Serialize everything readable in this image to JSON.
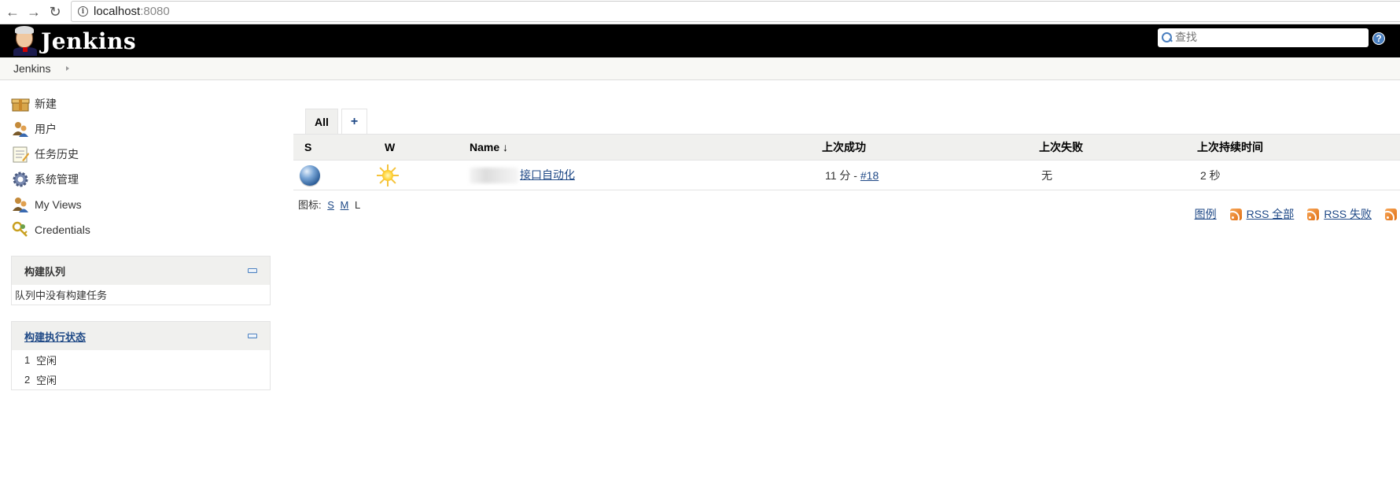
{
  "browser": {
    "url_host": "localhost",
    "url_port": ":8080",
    "back_icon": "←",
    "forward_icon": "→",
    "reload_icon": "↻"
  },
  "header": {
    "logo_text": "Jenkins",
    "search_placeholder": "查找",
    "help_icon": "?"
  },
  "breadcrumb": {
    "root": "Jenkins"
  },
  "sidebar": {
    "tasks": [
      {
        "label": "新建",
        "icon": "new-item-icon"
      },
      {
        "label": "用户",
        "icon": "users-icon"
      },
      {
        "label": "任务历史",
        "icon": "build-history-icon"
      },
      {
        "label": "系统管理",
        "icon": "manage-gear-icon"
      },
      {
        "label": "My Views",
        "icon": "my-views-icon"
      },
      {
        "label": "Credentials",
        "icon": "credentials-icon"
      }
    ],
    "build_queue": {
      "title": "构建队列",
      "empty_text": "队列中没有构建任务"
    },
    "executor_status": {
      "title": "构建执行状态",
      "executors": [
        {
          "num": "1",
          "status": "空闲"
        },
        {
          "num": "2",
          "status": "空闲"
        }
      ]
    }
  },
  "main": {
    "tabs": [
      {
        "label": "All"
      },
      {
        "label": "+"
      }
    ],
    "table": {
      "columns": [
        "S",
        "W",
        "Name  ↓",
        "上次成功",
        "上次失败",
        "上次持续时间"
      ],
      "rows": [
        {
          "status": "blue-ball",
          "weather": "sunny",
          "name_visible": "接口自动化",
          "last_success_text": "11 分 - ",
          "last_success_build": "#18",
          "last_failure": "无",
          "last_duration": "2 秒"
        }
      ]
    },
    "icon_size": {
      "label": "图标:",
      "sizes": [
        "S",
        "M",
        "L"
      ]
    },
    "footer_links": {
      "legend": "图例",
      "rss_all": "RSS 全部",
      "rss_failed": "RSS 失败"
    }
  },
  "colors": {
    "header_bg": "#000000",
    "link": "#204a87",
    "table_header_bg": "#f0f0ee"
  }
}
